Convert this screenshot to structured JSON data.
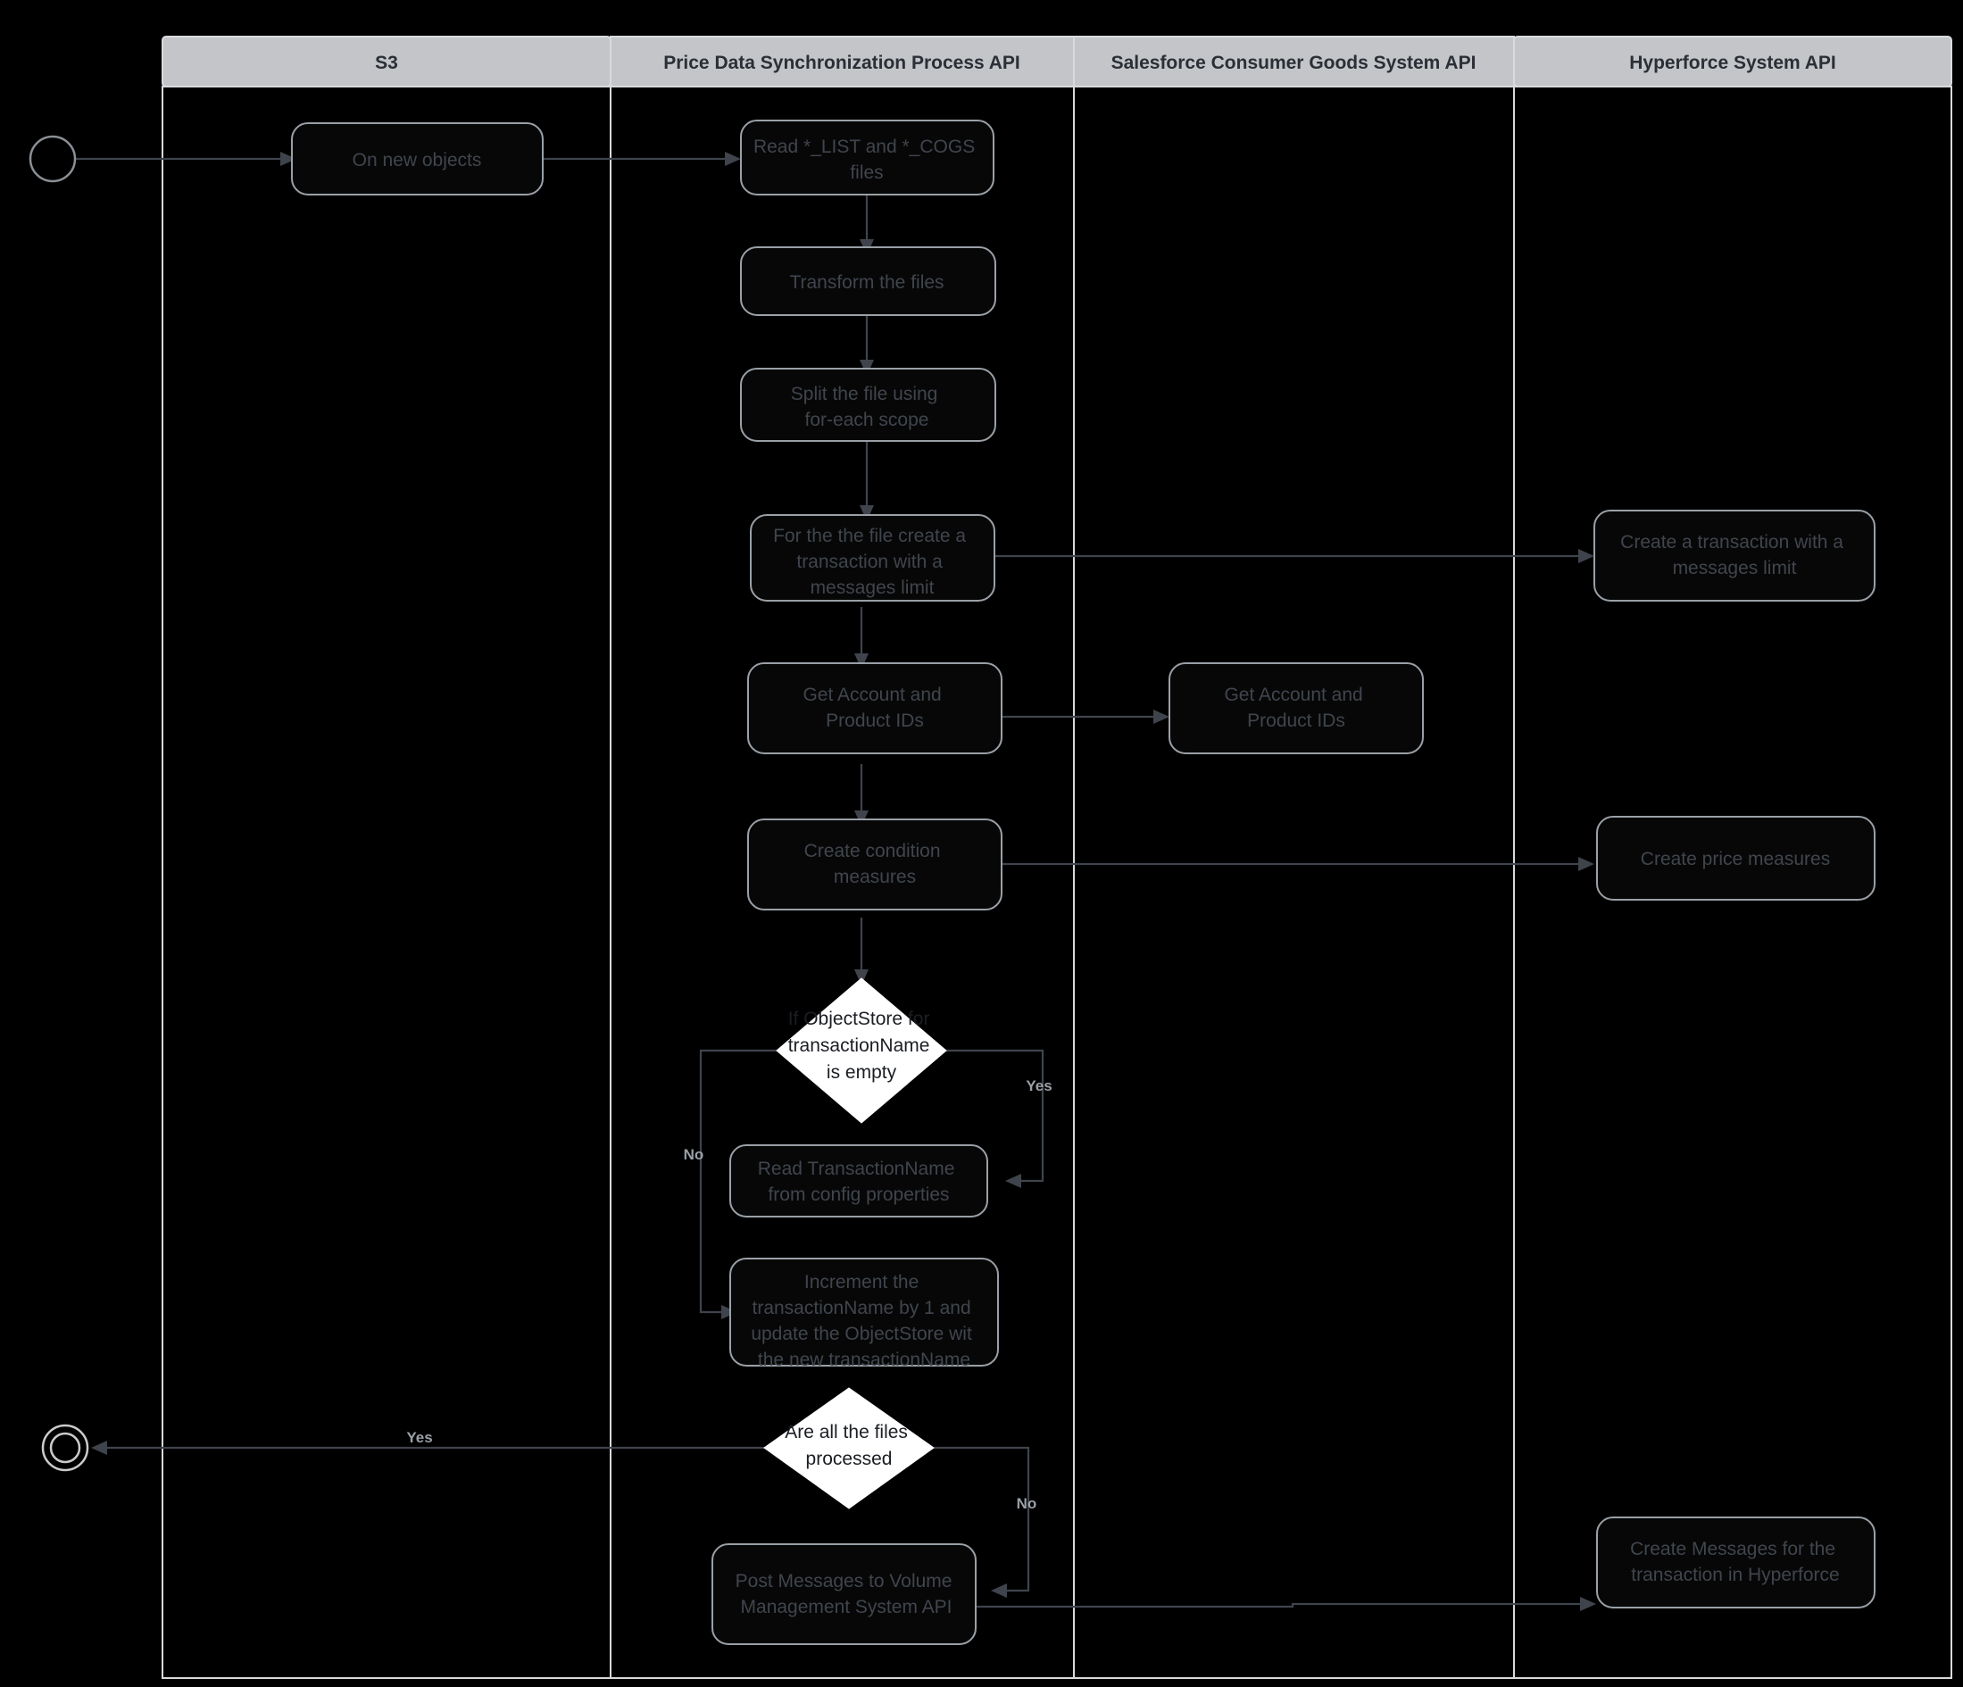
{
  "diagram": {
    "type": "swimlane-flowchart",
    "title": "Price Data Synchronization Process API",
    "colors": {
      "background": "#000000",
      "lane_header_fill": "#c3c5c8",
      "lane_header_text": "#2b2f36",
      "lane_border": "#d9dadc",
      "node_stroke": "#9aa0a6",
      "node_text": "#40454d",
      "decision_fill": "#ffffff",
      "decision_text": "#1b1e23",
      "connector": "#3f444c",
      "edge_label": "#9aa0a6"
    },
    "lanes": [
      {
        "id": "s3",
        "label": "S3"
      },
      {
        "id": "process",
        "label": "Price Data Synchronization Process API"
      },
      {
        "id": "salesforce",
        "label": "Salesforce Consumer Goods System API"
      },
      {
        "id": "hyperforce",
        "label": "Hyperforce System API"
      }
    ],
    "nodes": [
      {
        "id": "start",
        "lane": "s3",
        "shape": "start-circle",
        "label": ""
      },
      {
        "id": "on-new",
        "lane": "s3",
        "shape": "rounded-rect",
        "label": "On new objects"
      },
      {
        "id": "read-files",
        "lane": "process",
        "shape": "rounded-rect",
        "label": "Read *_LIST and *_COGS files"
      },
      {
        "id": "transform",
        "lane": "process",
        "shape": "rounded-rect",
        "label": "Transform the  files"
      },
      {
        "id": "split",
        "lane": "process",
        "shape": "rounded-rect",
        "label": "Split the file using for-each scope"
      },
      {
        "id": "create-txn",
        "lane": "process",
        "shape": "rounded-rect",
        "label": "For the the file create a transaction with a messages limit"
      },
      {
        "id": "get-ids-proc",
        "lane": "process",
        "shape": "rounded-rect",
        "label": "Get Account and Product IDs"
      },
      {
        "id": "cond-meas",
        "lane": "process",
        "shape": "rounded-rect",
        "label": "Create condition measures"
      },
      {
        "id": "if-objstore",
        "lane": "process",
        "shape": "diamond",
        "label": "If ObjectStore for transactionName is empty"
      },
      {
        "id": "read-txnname",
        "lane": "process",
        "shape": "rounded-rect",
        "label": "Read TransactionName from config properties"
      },
      {
        "id": "increment",
        "lane": "process",
        "shape": "rounded-rect",
        "label": "Increment the transactionName by 1 and update the ObjectStore wit the new transactionName"
      },
      {
        "id": "all-files",
        "lane": "process",
        "shape": "diamond",
        "label": "Are all the files processed"
      },
      {
        "id": "post-msgs",
        "lane": "process",
        "shape": "rounded-rect",
        "label": "Post Messages to Volume Management System API"
      },
      {
        "id": "end",
        "lane": "s3",
        "shape": "end-circle",
        "label": ""
      },
      {
        "id": "get-ids-sf",
        "lane": "salesforce",
        "shape": "rounded-rect",
        "label": "Get Account and Product IDs"
      },
      {
        "id": "hf-create-txn",
        "lane": "hyperforce",
        "shape": "rounded-rect",
        "label": "Create a transaction with a messages limit"
      },
      {
        "id": "hf-price",
        "lane": "hyperforce",
        "shape": "rounded-rect",
        "label": "Create price measures"
      },
      {
        "id": "hf-messages",
        "lane": "hyperforce",
        "shape": "rounded-rect",
        "label": "Create Messages for the transaction in Hyperforce"
      }
    ],
    "node_lines": {
      "on-new": [
        "On new objects"
      ],
      "read-files": [
        "Read *_LIST and *_COGS",
        "files"
      ],
      "transform": [
        "Transform the  files"
      ],
      "split": [
        "Split the file using",
        "for-each scope"
      ],
      "create-txn": [
        "For the the file create a",
        "transaction with a",
        "messages limit"
      ],
      "get-ids-proc": [
        "Get Account and",
        "Product IDs"
      ],
      "cond-meas": [
        "Create condition",
        "measures"
      ],
      "if-objstore": [
        "If ObjectStore for",
        "transactionName",
        "is empty"
      ],
      "read-txnname": [
        "Read TransactionName",
        "from config properties"
      ],
      "increment": [
        "Increment the",
        "transactionName by 1 and",
        "update the ObjectStore wit",
        "the new transactionName"
      ],
      "all-files": [
        "Are all the files",
        "processed"
      ],
      "post-msgs": [
        "Post Messages to Volume",
        "Management System API"
      ],
      "get-ids-sf": [
        "Get Account and",
        "Product IDs"
      ],
      "hf-create-txn": [
        "Create a transaction with a",
        "messages limit"
      ],
      "hf-price": [
        "Create price measures"
      ],
      "hf-messages": [
        "Create Messages for the",
        "transaction in Hyperforce"
      ]
    },
    "edges": [
      {
        "id": "e-start-onnew",
        "from": "start",
        "to": "on-new",
        "label": ""
      },
      {
        "id": "e-onnew-read",
        "from": "on-new",
        "to": "read-files",
        "label": ""
      },
      {
        "id": "e-read-transform",
        "from": "read-files",
        "to": "transform",
        "label": ""
      },
      {
        "id": "e-transform-split",
        "from": "transform",
        "to": "split",
        "label": ""
      },
      {
        "id": "e-split-createtxn",
        "from": "split",
        "to": "create-txn",
        "label": ""
      },
      {
        "id": "e-createtxn-hf",
        "from": "create-txn",
        "to": "hf-create-txn",
        "label": ""
      },
      {
        "id": "e-createtxn-ids",
        "from": "create-txn",
        "to": "get-ids-proc",
        "label": ""
      },
      {
        "id": "e-ids-sf",
        "from": "get-ids-proc",
        "to": "get-ids-sf",
        "label": ""
      },
      {
        "id": "e-ids-cond",
        "from": "get-ids-proc",
        "to": "cond-meas",
        "label": ""
      },
      {
        "id": "e-cond-hfprice",
        "from": "cond-meas",
        "to": "hf-price",
        "label": ""
      },
      {
        "id": "e-cond-if",
        "from": "cond-meas",
        "to": "if-objstore",
        "label": ""
      },
      {
        "id": "e-if-yes",
        "from": "if-objstore",
        "to": "read-txnname",
        "label": "Yes"
      },
      {
        "id": "e-if-no",
        "from": "if-objstore",
        "to": "increment",
        "label": "No"
      },
      {
        "id": "e-all-yes",
        "from": "all-files",
        "to": "end",
        "label": "Yes"
      },
      {
        "id": "e-all-no",
        "from": "all-files",
        "to": "post-msgs",
        "label": "No"
      },
      {
        "id": "e-hfmsg-post",
        "from": "hf-messages",
        "to": "post-msgs",
        "label": ""
      },
      {
        "id": "e-post-hfmsg",
        "from": "post-msgs",
        "to": "hf-messages",
        "label": ""
      }
    ],
    "edge_labels": {
      "if_yes": "Yes",
      "if_no": "No",
      "all_yes": "Yes",
      "all_no": "No"
    }
  }
}
